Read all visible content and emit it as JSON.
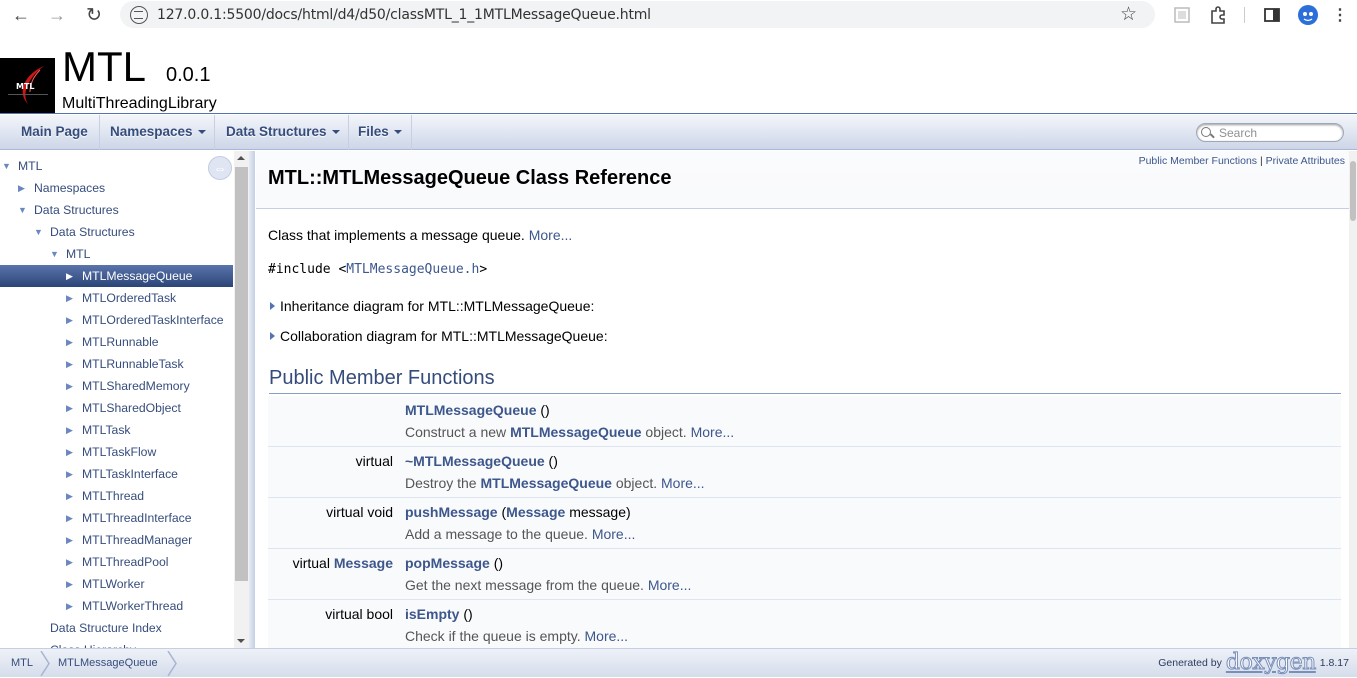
{
  "browser": {
    "url": "127.0.0.1:5500/docs/html/d4/d50/classMTL_1_1MTLMessageQueue.html"
  },
  "header": {
    "project_name": "MTL",
    "project_number": "0.0.1",
    "project_brief": "MultiThreadingLibrary"
  },
  "menu": {
    "items": [
      {
        "label": "Main Page"
      },
      {
        "label": "Namespaces"
      },
      {
        "label": "Data Structures"
      },
      {
        "label": "Files"
      }
    ],
    "search_placeholder": "Search"
  },
  "tree": {
    "items": [
      {
        "label": "MTL",
        "arrow": "▼"
      },
      {
        "label": "Namespaces",
        "arrow": "▶"
      },
      {
        "label": "Data Structures",
        "arrow": "▼"
      },
      {
        "label": "Data Structures",
        "arrow": "▼"
      },
      {
        "label": "MTL",
        "arrow": "▼"
      },
      {
        "label": "MTLMessageQueue",
        "arrow": "▶"
      },
      {
        "label": "MTLOrderedTask",
        "arrow": "▶"
      },
      {
        "label": "MTLOrderedTaskInterface",
        "arrow": "▶"
      },
      {
        "label": "MTLRunnable",
        "arrow": "▶"
      },
      {
        "label": "MTLRunnableTask",
        "arrow": "▶"
      },
      {
        "label": "MTLSharedMemory",
        "arrow": "▶"
      },
      {
        "label": "MTLSharedObject",
        "arrow": "▶"
      },
      {
        "label": "MTLTask",
        "arrow": "▶"
      },
      {
        "label": "MTLTaskFlow",
        "arrow": "▶"
      },
      {
        "label": "MTLTaskInterface",
        "arrow": "▶"
      },
      {
        "label": "MTLThread",
        "arrow": "▶"
      },
      {
        "label": "MTLThreadInterface",
        "arrow": "▶"
      },
      {
        "label": "MTLThreadManager",
        "arrow": "▶"
      },
      {
        "label": "MTLThreadPool",
        "arrow": "▶"
      },
      {
        "label": "MTLWorker",
        "arrow": "▶"
      },
      {
        "label": "MTLWorkerThread",
        "arrow": "▶"
      },
      {
        "label": "Data Structure Index",
        "arrow": ""
      },
      {
        "label": "Class Hierarchy",
        "arrow": ""
      }
    ]
  },
  "doc": {
    "summary_public": "Public Member Functions",
    "summary_sep": " | ",
    "summary_private": "Private Attributes",
    "title": "MTL::MTLMessageQueue Class Reference",
    "brief": "Class that implements a message queue. ",
    "more": "More...",
    "include_prefix": "#include <",
    "include_file": "MTLMessageQueue.h",
    "include_suffix": ">",
    "inheritance": "Inheritance diagram for MTL::MTLMessageQueue:",
    "collaboration": "Collaboration diagram for MTL::MTLMessageQueue:",
    "section_title": "Public Member Functions",
    "members": [
      {
        "left": "",
        "left_link": "",
        "name": "MTLMessageQueue",
        "args": " ()",
        "desc_pre": "Construct a new ",
        "desc_link": "MTLMessageQueue",
        "desc_post": " object. ",
        "more": "More..."
      },
      {
        "left": "virtual",
        "left_link": "",
        "name": "~MTLMessageQueue",
        "args": " ()",
        "desc_pre": "Destroy the ",
        "desc_link": "MTLMessageQueue",
        "desc_post": " object. ",
        "more": "More..."
      },
      {
        "left": "virtual void",
        "left_link": "",
        "name": "pushMessage",
        "args_pre": " (",
        "args_link": "Message",
        "args_post": " message)",
        "desc_pre": "Add a message to the queue. ",
        "desc_link": "",
        "desc_post": "",
        "more": "More..."
      },
      {
        "left": "virtual ",
        "left_link": "Message",
        "name": "popMessage",
        "args": " ()",
        "desc_pre": "Get the next message from the queue. ",
        "desc_link": "",
        "desc_post": "",
        "more": "More..."
      },
      {
        "left": "virtual bool",
        "left_link": "",
        "name": "isEmpty",
        "args": " ()",
        "desc_pre": "Check if the queue is empty. ",
        "desc_link": "",
        "desc_post": "",
        "more": "More..."
      }
    ]
  },
  "footer": {
    "crumbs": [
      "MTL",
      "MTLMessageQueue"
    ],
    "generated_by": "Generated by",
    "doxygen": "doxygen",
    "version": "1.8.17"
  }
}
